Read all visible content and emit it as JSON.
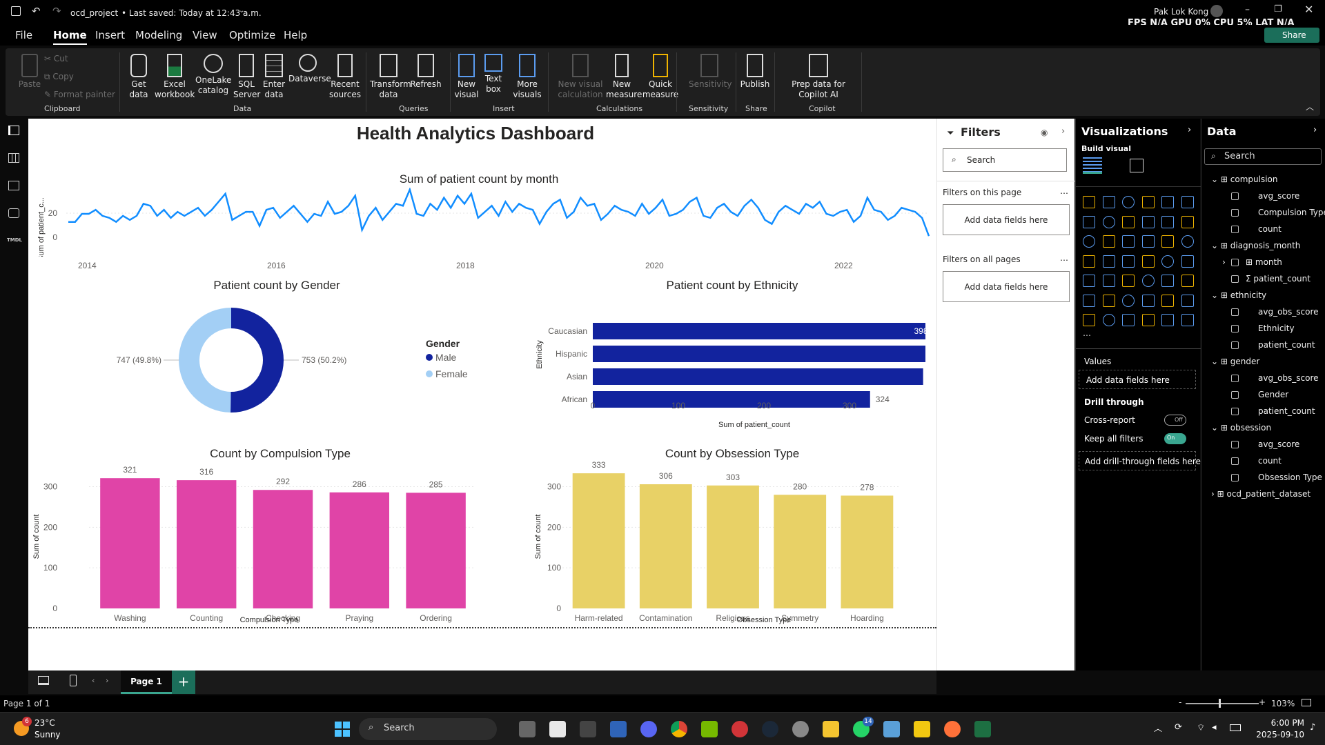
{
  "titlebar": {
    "project": "ocd_project",
    "saved": "• Last saved: Today at 12:43 a.m.",
    "user": "Pak Lok Kong",
    "perf": "FPS N/A GPU 0% CPU 5% LAT N/A",
    "share": "Share"
  },
  "menu": [
    "File",
    "Home",
    "Insert",
    "Modeling",
    "View",
    "Optimize",
    "Help"
  ],
  "ribbon": {
    "clipboard": {
      "paste": "Paste",
      "cut": "Cut",
      "copy": "Copy",
      "format": "Format painter",
      "group": "Clipboard"
    },
    "data": {
      "get": "Get data",
      "excel": "Excel workbook",
      "onelake": "OneLake catalog",
      "sql": "SQL Server",
      "enter": "Enter data",
      "dataverse": "Dataverse",
      "recent": "Recent sources",
      "group": "Data"
    },
    "queries": {
      "transform": "Transform data",
      "refresh": "Refresh",
      "group": "Queries"
    },
    "insert": {
      "newvisual": "New visual",
      "textbox": "Text box",
      "more": "More visuals",
      "group": "Insert"
    },
    "calc": {
      "newvisualcalc": "New visual calculation",
      "newmeasure": "New measure",
      "quick": "Quick measure",
      "group": "Calculations"
    },
    "sensitivity": {
      "label": "Sensitivity",
      "group": "Sensitivity"
    },
    "share": {
      "publish": "Publish",
      "group": "Share"
    },
    "copilot": {
      "prep": "Prep data for Copilot AI",
      "group": "Copilot"
    }
  },
  "dashboard_title": "Health Analytics Dashboard",
  "charts": {
    "line": {
      "title": "Sum of patient count by month",
      "ylabel": "Sum of patient_c...",
      "yticks": [
        "20",
        "0"
      ],
      "xticks": [
        "2014",
        "2016",
        "2018",
        "2020",
        "2022"
      ]
    },
    "gender": {
      "title": "Patient count by Gender",
      "legend_title": "Gender",
      "male": "Male",
      "female": "Female",
      "male_label": "753 (50.2%)",
      "female_label": "747 (49.8%)"
    },
    "ethnicity": {
      "title": "Patient count by Ethnicity",
      "ylabel": "Ethnicity",
      "xlabel": "Sum of patient_count",
      "xticks": [
        "0",
        "100",
        "200",
        "300",
        "400"
      ]
    },
    "compulsion": {
      "title": "Count by Compulsion Type",
      "ylabel": "Sum of count",
      "xlabel": "Compulsion Type",
      "yticks": [
        "300",
        "200",
        "100",
        "0"
      ]
    },
    "obsession": {
      "title": "Count by Obsession Type",
      "ylabel": "Sum of count",
      "xlabel": "Obsession Type",
      "yticks": [
        "300",
        "200",
        "100",
        "0"
      ]
    }
  },
  "chart_data": [
    {
      "type": "line",
      "title": "Sum of patient count by month",
      "ylabel": "Sum of patient_c...",
      "ylim": [
        0,
        26
      ],
      "xlim": [
        "2013-01",
        "2024-06"
      ],
      "x_start": "2013-01",
      "x_step": "month",
      "values": [
        9,
        9,
        13,
        13,
        15,
        12,
        11,
        9,
        12,
        10,
        12,
        18,
        17,
        12,
        15,
        11,
        14,
        12,
        14,
        16,
        12,
        15,
        19,
        23,
        10,
        12,
        14,
        14,
        7,
        15,
        16,
        11,
        14,
        17,
        13,
        9,
        13,
        12,
        19,
        13,
        14,
        17,
        22,
        5,
        12,
        16,
        10,
        14,
        18,
        17,
        25,
        13,
        12,
        18,
        15,
        21,
        16,
        22,
        18,
        23,
        11,
        14,
        17,
        12,
        19,
        14,
        18,
        16,
        15,
        8,
        14,
        18,
        20,
        11,
        14,
        21,
        17,
        18,
        10,
        13,
        17,
        15,
        14,
        12,
        18,
        13,
        16,
        20,
        12,
        13,
        15,
        19,
        21,
        12,
        11,
        16,
        18,
        14,
        12,
        17,
        20,
        16,
        10,
        8,
        14,
        17,
        15,
        13,
        18,
        16,
        19,
        13,
        12,
        14,
        15,
        9,
        12,
        21,
        15,
        14,
        10,
        12,
        16,
        15,
        14,
        11,
        2
      ]
    },
    {
      "type": "pie",
      "title": "Patient count by Gender",
      "categories": [
        "Male",
        "Female"
      ],
      "values": [
        753,
        747
      ],
      "colors": [
        "#12239e",
        "#a3cff5"
      ]
    },
    {
      "type": "bar",
      "orientation": "horizontal",
      "title": "Patient count by Ethnicity",
      "categories": [
        "Caucasian",
        "Hispanic",
        "Asian",
        "African"
      ],
      "values": [
        398,
        392,
        386,
        324
      ],
      "xlabel": "Sum of patient_count",
      "ylabel": "Ethnicity",
      "xlim": [
        0,
        400
      ],
      "color": "#12239e"
    },
    {
      "type": "bar",
      "title": "Count by Compulsion Type",
      "categories": [
        "Washing",
        "Counting",
        "Checking",
        "Praying",
        "Ordering"
      ],
      "values": [
        321,
        316,
        292,
        286,
        285
      ],
      "xlabel": "Compulsion Type",
      "ylabel": "Sum of count",
      "ylim": [
        0,
        340
      ],
      "color": "#e044a7"
    },
    {
      "type": "bar",
      "title": "Count by Obsession Type",
      "categories": [
        "Harm-related",
        "Contamination",
        "Religious",
        "Symmetry",
        "Hoarding"
      ],
      "values": [
        333,
        306,
        303,
        280,
        278
      ],
      "xlabel": "Obsession Type",
      "ylabel": "Sum of count",
      "ylim": [
        0,
        340
      ],
      "color": "#e8d166"
    }
  ],
  "filters": {
    "title": "Filters",
    "search": "Search",
    "on_page": "Filters on this page",
    "on_all": "Filters on all pages",
    "add": "Add data fields here"
  },
  "viz": {
    "title": "Visualizations",
    "build": "Build visual",
    "values": "Values",
    "add_values": "Add data fields here",
    "drill": "Drill through",
    "cross": "Cross-report",
    "cross_state": "Off",
    "keep": "Keep all filters",
    "keep_state": "On",
    "add_drill": "Add drill-through fields here"
  },
  "data": {
    "title": "Data",
    "search": "Search",
    "tables": [
      {
        "name": "compulsion",
        "fields": [
          "avg_score",
          "Compulsion Type",
          "count"
        ]
      },
      {
        "name": "diagnosis_month",
        "fields": [
          "month",
          "patient_count"
        ]
      },
      {
        "name": "ethnicity",
        "fields": [
          "avg_obs_score",
          "Ethnicity",
          "patient_count"
        ]
      },
      {
        "name": "gender",
        "fields": [
          "avg_obs_score",
          "Gender",
          "patient_count"
        ]
      },
      {
        "name": "obsession",
        "fields": [
          "avg_score",
          "count",
          "Obsession Type"
        ]
      }
    ],
    "collapsed": "ocd_patient_dataset"
  },
  "pages": {
    "current": "Page 1",
    "status": "Page 1 of 1",
    "zoom": "103%"
  },
  "taskbar": {
    "temp": "23°C",
    "weather": "Sunny",
    "search": "Search",
    "time": "6:00 PM",
    "date": "2025-09-10",
    "badge": "6",
    "wa_badge": "14"
  }
}
